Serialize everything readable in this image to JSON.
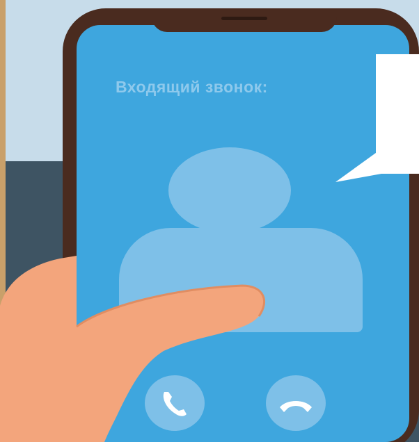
{
  "call_screen": {
    "title": "Входящий звонок:"
  },
  "icons": {
    "accept": "phone-accept-icon",
    "decline": "phone-decline-icon",
    "avatar": "user-avatar-icon",
    "speech": "speech-bubble-icon"
  },
  "colors": {
    "screen": "#3ea6de",
    "avatar": "#7ec0e8",
    "phone_frame": "#4a2b1f",
    "hand": "#f3a57c",
    "wall": "#c7dcea"
  }
}
